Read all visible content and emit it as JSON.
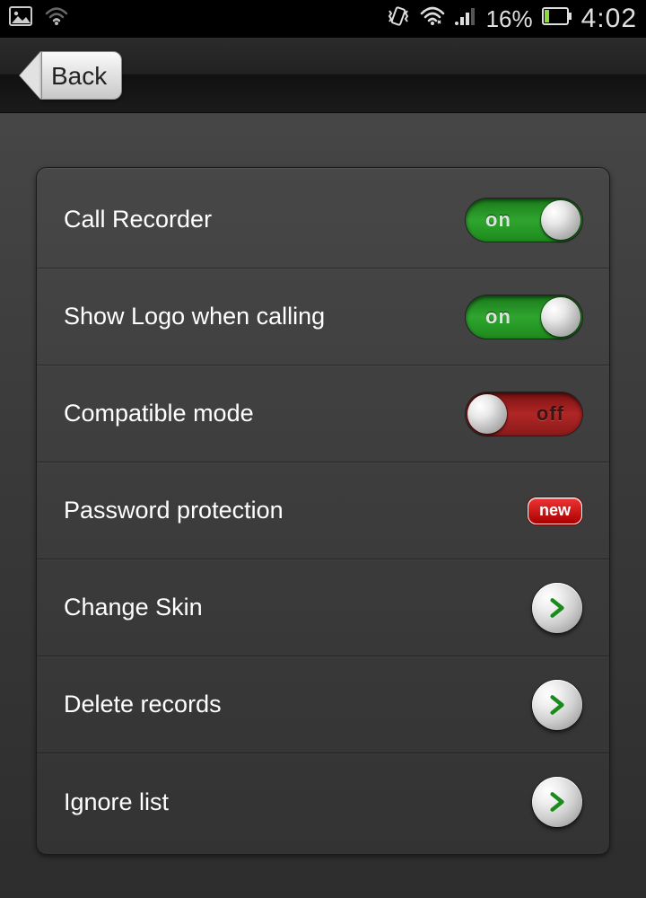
{
  "status": {
    "battery_pct": "16%",
    "clock": "4:02"
  },
  "nav": {
    "back_label": "Back"
  },
  "settings": {
    "rows": [
      {
        "label": "Call Recorder",
        "kind": "toggle",
        "state": "on",
        "toggle_text": "on"
      },
      {
        "label": "Show Logo when calling",
        "kind": "toggle",
        "state": "on",
        "toggle_text": "on"
      },
      {
        "label": "Compatible mode",
        "kind": "toggle",
        "state": "off",
        "toggle_text": "off"
      },
      {
        "label": "Password protection",
        "kind": "badge",
        "badge_text": "new"
      },
      {
        "label": "Change Skin",
        "kind": "nav"
      },
      {
        "label": "Delete records",
        "kind": "nav"
      },
      {
        "label": "Ignore list",
        "kind": "nav"
      }
    ]
  }
}
